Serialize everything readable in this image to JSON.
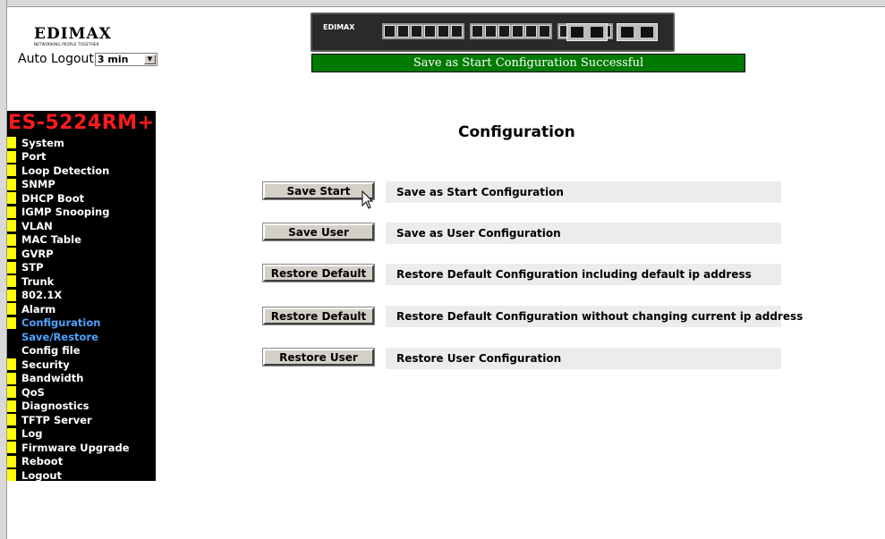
{
  "header": {
    "brand": "EDIMAX",
    "brand_tagline": "NETWORKING PEOPLE TOGETHER",
    "auto_logout_label": "Auto Logout",
    "auto_logout_value": "3 min",
    "switch_logo": "EDIMAX",
    "status_message": "Save as Start Configuration Successful",
    "status_color": "#007a00"
  },
  "sidebar": {
    "model": "ES-5224RM+",
    "items": [
      {
        "label": "System"
      },
      {
        "label": "Port"
      },
      {
        "label": "Loop Detection"
      },
      {
        "label": "SNMP"
      },
      {
        "label": "DHCP Boot"
      },
      {
        "label": "IGMP Snooping"
      },
      {
        "label": "VLAN"
      },
      {
        "label": "MAC Table"
      },
      {
        "label": "GVRP"
      },
      {
        "label": "STP"
      },
      {
        "label": "Trunk"
      },
      {
        "label": "802.1X"
      },
      {
        "label": "Alarm"
      },
      {
        "label": "Configuration"
      },
      {
        "label": "Save/Restore"
      },
      {
        "label": "Config file"
      },
      {
        "label": "Security"
      },
      {
        "label": "Bandwidth"
      },
      {
        "label": "QoS"
      },
      {
        "label": "Diagnostics"
      },
      {
        "label": "TFTP Server"
      },
      {
        "label": "Log"
      },
      {
        "label": "Firmware Upgrade"
      },
      {
        "label": "Reboot"
      },
      {
        "label": "Logout"
      }
    ]
  },
  "main": {
    "title": "Configuration",
    "actions": [
      {
        "button": "Save Start",
        "description": "Save as Start Configuration"
      },
      {
        "button": "Save User",
        "description": "Save as User Configuration"
      },
      {
        "button": "Restore Default",
        "description": "Restore Default Configuration including default ip address"
      },
      {
        "button": "Restore Default",
        "description": "Restore Default Configuration without changing current ip address"
      },
      {
        "button": "Restore User",
        "description": "Restore User Configuration"
      }
    ]
  }
}
